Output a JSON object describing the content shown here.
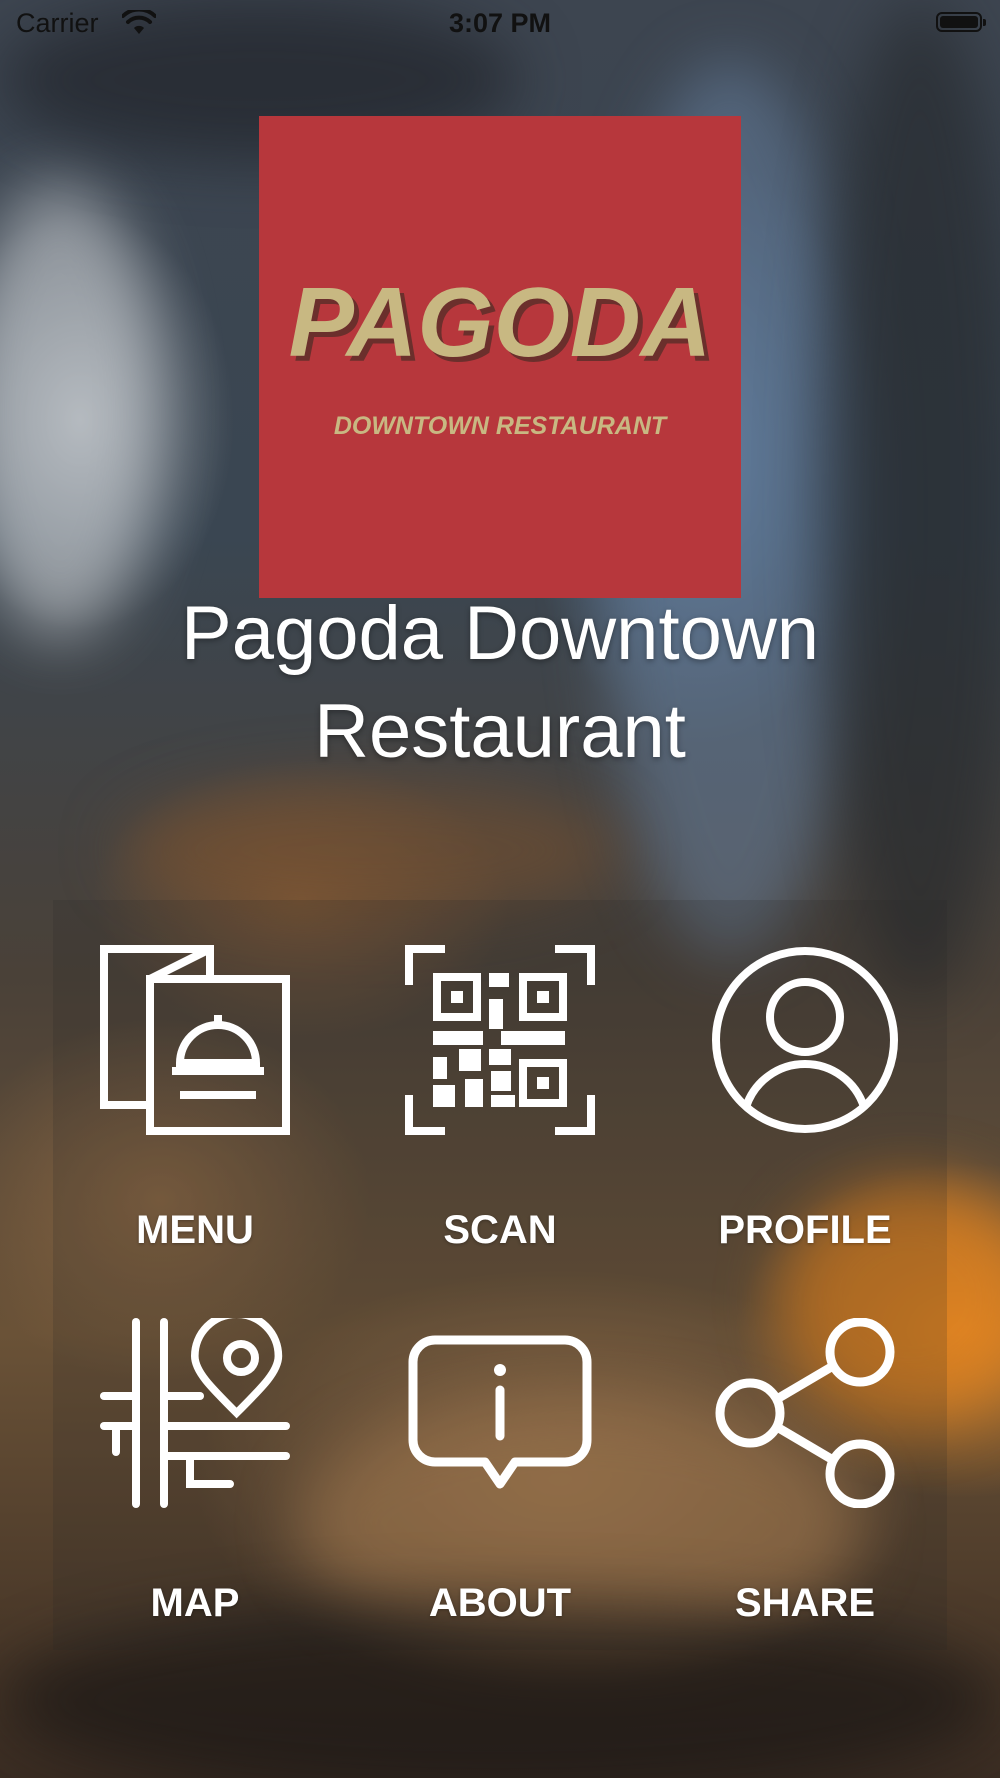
{
  "status_bar": {
    "carrier": "Carrier",
    "time": "3:07 PM"
  },
  "logo": {
    "brand": "PAGODA",
    "tagline": "DOWNTOWN RESTAURANT",
    "background_color": "#b7373c",
    "text_color": "#c8b882"
  },
  "restaurant": {
    "name_line1": "Pagoda Downtown",
    "name_line2": "Restaurant"
  },
  "grid": {
    "items": [
      {
        "label": "MENU",
        "icon": "menu-icon"
      },
      {
        "label": "SCAN",
        "icon": "qr-code-icon"
      },
      {
        "label": "PROFILE",
        "icon": "profile-icon"
      },
      {
        "label": "MAP",
        "icon": "map-pin-icon"
      },
      {
        "label": "ABOUT",
        "icon": "info-icon"
      },
      {
        "label": "SHARE",
        "icon": "share-icon"
      }
    ]
  }
}
